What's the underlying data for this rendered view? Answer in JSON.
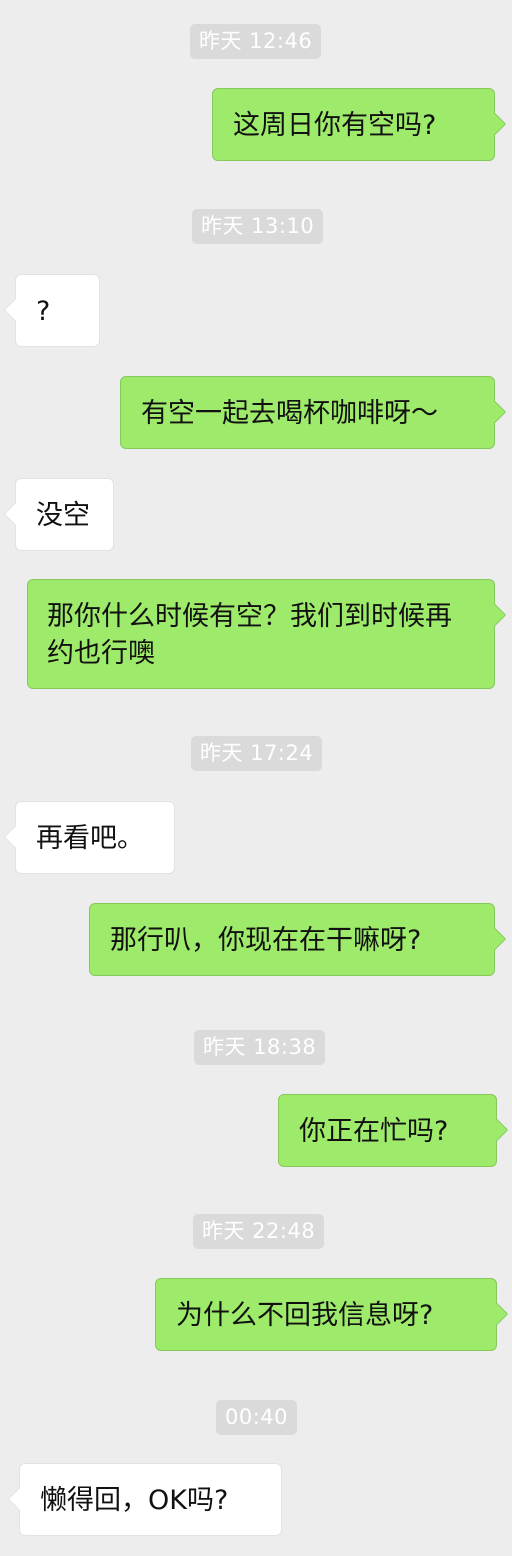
{
  "chat": {
    "timestamps": [
      "昨天 12:46",
      "昨天 13:10",
      "昨天 17:24",
      "昨天 18:38",
      "昨天 22:48",
      "00:40"
    ],
    "messages": [
      {
        "sender": "me",
        "text": "这周日你有空吗?"
      },
      {
        "sender": "other",
        "text": "?"
      },
      {
        "sender": "me",
        "text": "有空一起去喝杯咖啡呀～"
      },
      {
        "sender": "other",
        "text": "没空"
      },
      {
        "sender": "me",
        "text": "那你什么时候有空？我们到时候再约也行噢"
      },
      {
        "sender": "other",
        "text": "再看吧。"
      },
      {
        "sender": "me",
        "text": "那行叭，你现在在干嘛呀?"
      },
      {
        "sender": "me",
        "text": "你正在忙吗?"
      },
      {
        "sender": "me",
        "text": "为什么不回我信息呀?"
      },
      {
        "sender": "other",
        "text": "懒得回，OK吗?"
      }
    ]
  },
  "colors": {
    "background": "#ededed",
    "sent_bubble": "#9eea6a",
    "received_bubble": "#ffffff",
    "timestamp_chip": "#dadada"
  }
}
